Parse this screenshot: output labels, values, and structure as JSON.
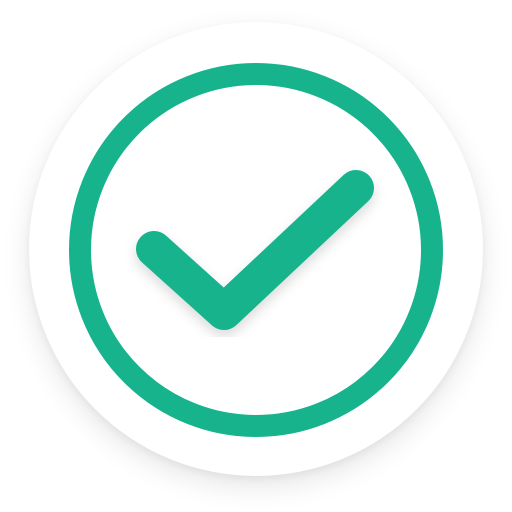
{
  "icon": {
    "name": "check-circle-icon",
    "accent_color": "#16b38c",
    "background_color": "#ffffff"
  }
}
